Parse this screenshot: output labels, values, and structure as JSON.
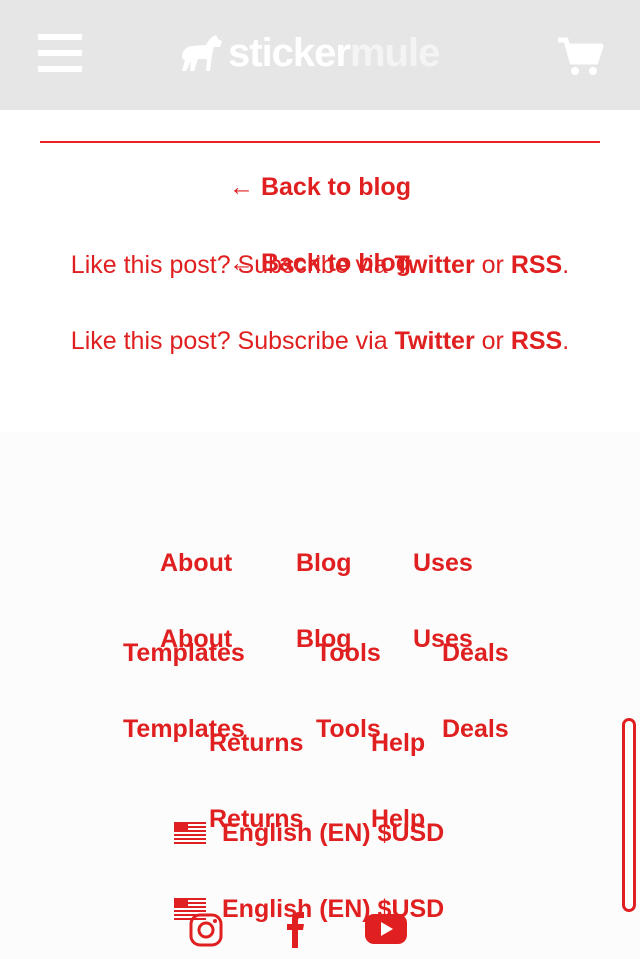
{
  "header": {
    "logo_sticker": "sticker",
    "logo_mule": "mule",
    "menu_icon": "hamburger-menu-icon",
    "cart_icon": "shopping-cart-icon",
    "background": "#e6e6e6"
  },
  "post_footer": {
    "back_label": "← Back to blog",
    "subscribe_prefix": "Like this post? Subscribe via",
    "twitter": "Twitter",
    "or": "or",
    "rss": "RSS",
    "period": ".",
    "accent": "#e02020"
  },
  "footer": {
    "links": {
      "about": "About",
      "blog": "Blog",
      "uses": "Uses",
      "templates": "Templates",
      "tools": "Tools",
      "deals": "Deals",
      "returns": "Returns",
      "help": "Help"
    },
    "locale": "English (EN) $USD",
    "flag_icon": "us-flag-icon",
    "social": [
      "instagram-icon",
      "facebook-icon",
      "youtube-icon"
    ]
  }
}
